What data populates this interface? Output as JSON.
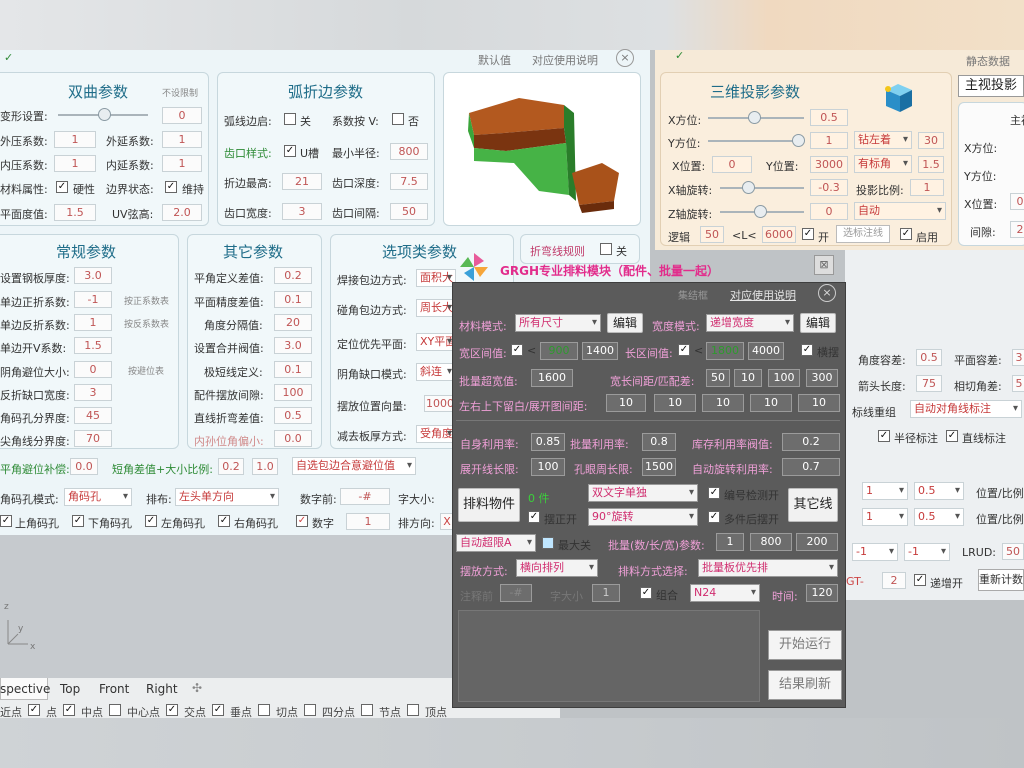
{
  "top": {
    "default_label": "默认值",
    "help_label": "对应使用说明",
    "right_static": "静态数据"
  },
  "hyper": {
    "title": "双曲参数",
    "reset": "不设限制",
    "deform": "变形设置:",
    "deform_v": "0",
    "outer": "外压系数:",
    "outer_v": "1",
    "outer_ext": "外延系数:",
    "outer_ext_v": "1",
    "inner": "内压系数:",
    "inner_v": "1",
    "inner_ext": "内延系数:",
    "inner_ext_v": "1",
    "mat": "材料属性:",
    "hard": "硬性",
    "edge": "边界状态:",
    "keep": "维持",
    "flat": "平面度值:",
    "flat_v": "1.5",
    "uv": "UV弦高:",
    "uv_v": "2.0"
  },
  "arc": {
    "title": "弧折边参数",
    "edge_on": "弧线边启:",
    "close": "关",
    "coef": "系数按 V:",
    "no": "否",
    "notch": "齿口样式:",
    "u": "U槽",
    "minr": "最小半径:",
    "minr_v": "800",
    "fold": "折边最高:",
    "fold_v": "21",
    "depth": "齿口深度:",
    "depth_v": "7.5",
    "width": "齿口宽度:",
    "width_v": "3",
    "gap": "齿口间隔:",
    "gap_v": "50"
  },
  "common": {
    "title": "常规参数",
    "l1": "设置钢板厚度:",
    "v1": "3.0",
    "l2": "单边正折系数:",
    "v2": "-1",
    "b2": "按正系数表",
    "l3": "单边反折系数:",
    "v3": "1",
    "b3": "按反系数表",
    "l4": "单边开V系数:",
    "v4": "1.5",
    "l5": "阴角避位大小:",
    "v5": "0",
    "b5": "按避位表",
    "l6": "反折缺口宽度:",
    "v6": "3",
    "l7": "角码孔分界度:",
    "v7": "45",
    "l8": "尖角线分界度:",
    "v8": "70"
  },
  "other": {
    "title": "其它参数",
    "l1": "平角定义差值:",
    "v1": "0.2",
    "l2": "平面精度差值:",
    "v2": "0.1",
    "l3": "角度分隔值:",
    "v3": "20",
    "l4": "设置合并阀值:",
    "v4": "3.0",
    "l5": "极短线定义:",
    "v5": "0.1",
    "l6": "配件摆放间隙:",
    "v6": "100",
    "l7": "直线折弯差值:",
    "v7": "0.5",
    "l8": "内孙位角偏小:",
    "v8": "0.0"
  },
  "options": {
    "title": "选项类参数",
    "fold_rule": "折弯线规则",
    "close": "关",
    "l1": "焊接包边方式:",
    "d1": "面积大",
    "l2": "碰角包边方式:",
    "d2": "周长大",
    "l3": "定位优先平面:",
    "d3": "XY平面",
    "l4": "阴角缺口模式:",
    "d4": "斜连",
    "l5": "摆放位置向量:",
    "v5": "1000",
    "l6": "减去板厚方式:",
    "d6": "受角度"
  },
  "bottom": {
    "flat_comp": "平角避位补偿:",
    "flat_comp_v": "0.0",
    "short_diff": "短角差值+大小比例:",
    "sd1": "0.2",
    "sd2": "1.0",
    "auto_edge": "自选包边合意避位值",
    "hole_mode": "角码孔模式:",
    "hole_v": "角码孔",
    "layout": "排布:",
    "layout_v": "左头单方向",
    "up": "上角码孔",
    "down": "下角码孔",
    "left": "左角码孔",
    "right": "右角码孔",
    "prefix": "数字前:",
    "prefix_v": "-#",
    "fsize": "字大小:",
    "digits": "数字",
    "digits_v": "1",
    "dir": "排方向:",
    "dir_v": "X"
  },
  "tabs": [
    "spective",
    "Top",
    "Front",
    "Right"
  ],
  "snaps": [
    "近点",
    "点",
    "中点",
    "中心点",
    "交点",
    "垂点",
    "切点",
    "四分点",
    "节点",
    "顶点"
  ],
  "axis": {
    "y": "y",
    "x": "x",
    "z": "z"
  },
  "proj": {
    "title": "三维投影参数",
    "main_view": "主视投影",
    "xpos": "X方位:",
    "xpos_v": "0.5",
    "ypos": "Y方位:",
    "ypos_v": "1",
    "ycorner": "钻左着",
    "ycorner_v": "30",
    "xloc": "X位置:",
    "xloc_v": "0",
    "yloc": "Y位置:",
    "yloc_v": "3000",
    "mark": "有标角",
    "mark_v": "1.5",
    "xrot": "X轴旋转:",
    "xrot_v": "-0.3",
    "scale": "投影比例:",
    "scale_v": "1",
    "zrot": "Z轴旋转:",
    "zrot_v": "0",
    "auto": "自动",
    "logic": "逻辑",
    "logic_v": "50",
    "l_lbl": "<L<",
    "l_v": "6000",
    "open": "开",
    "sel_line": "选标注线",
    "enable": "启用"
  },
  "top_right": {
    "r_main": "主初",
    "r_x": "X方位:",
    "r_y": "Y方位:",
    "r_xloc": "X位置:",
    "r_xloc_v": "0",
    "r_gap": "间隙:",
    "r_gap_v": "2"
  },
  "right2": {
    "angle_tol": "角度容差:",
    "angle_tol_v": "0.5",
    "plane_tol": "平面容差:",
    "plane_tol_v": "3",
    "arrow": "箭头长度:",
    "arrow_v": "75",
    "cut": "相切角差:",
    "cut_v": "5",
    "mark_group": "标线重组",
    "auto_diag": "自动对角线标注",
    "radius": "半径标注",
    "straight": "直线标注",
    "pos1": "位置/比例",
    "pos2": "位置/比例",
    "d1": "1",
    "d2": "0.5",
    "d3": "1",
    "d4": "0.5",
    "lrud": "LRUD:",
    "lrud_v": "50",
    "m1": "-1",
    "m2": "-1",
    "gt": "GT-",
    "gt_v": "2",
    "inc": "递增开",
    "recalc": "重新计数"
  },
  "dialog": {
    "brand": "GRGH专业排料模块（配件、批量一起）",
    "title": "集结框",
    "help": "对应使用说明",
    "mat_mode": "材料模式:",
    "mat_v": "所有尺寸",
    "edit": "编辑",
    "width_mode": "宽度模式:",
    "width_v": "递增宽度",
    "width_edit": "编辑",
    "w_range": "宽区间值:",
    "w_min": "900",
    "w_max": "1400",
    "l_range": "长区间值:",
    "l_min": "1800",
    "l_max": "4000",
    "horiz": "横摆",
    "batch_w": "批量超宽值:",
    "batch_w_v": "1600",
    "wl_gap": "宽长间距/匹配差:",
    "g1": "50",
    "g2": "10",
    "g3": "100",
    "g4": "300",
    "margins": "左右上下留白/展开图间距:",
    "m1": "10",
    "m2": "10",
    "m3": "10",
    "m4": "10",
    "m5": "10",
    "self_rate": "自身利用率:",
    "self_v": "0.85",
    "batch_rate": "批量利用率:",
    "batch_v": "0.8",
    "stock_rate": "库存利用率阀值:",
    "stock_v": "0.2",
    "unfold_len": "展开线长限:",
    "unfold_v": "100",
    "hole_len": "孔眼周长限:",
    "hole_v": "1500",
    "auto_rot": "自动旋转利用率:",
    "auto_rot_v": "0.7",
    "arrange": "排料物件",
    "other_line": "其它线",
    "count": "0 件",
    "double": "双文字单独",
    "num_check": "编号检测开",
    "place_front": "摆正开",
    "rot90": "90°旋转",
    "multi": "多件后摆开",
    "auto_lim": "自动超限A",
    "max_off": "最大关",
    "batch_params": "批量(数/长/宽)参数:",
    "bp1": "1",
    "bp2": "800",
    "bp3": "200",
    "place_mode": "摆放方式:",
    "place_v": "横向排列",
    "arrange_mode": "排料方式选择:",
    "arrange_v": "批量板优先排",
    "seq": "注释前",
    "seq_v": "-#",
    "font_size": "字大小",
    "font_v": "1",
    "combine": "组合",
    "n_v": "N24",
    "time": "时间:",
    "time_v": "120",
    "start": "开始运行",
    "refresh": "结果刷新"
  }
}
